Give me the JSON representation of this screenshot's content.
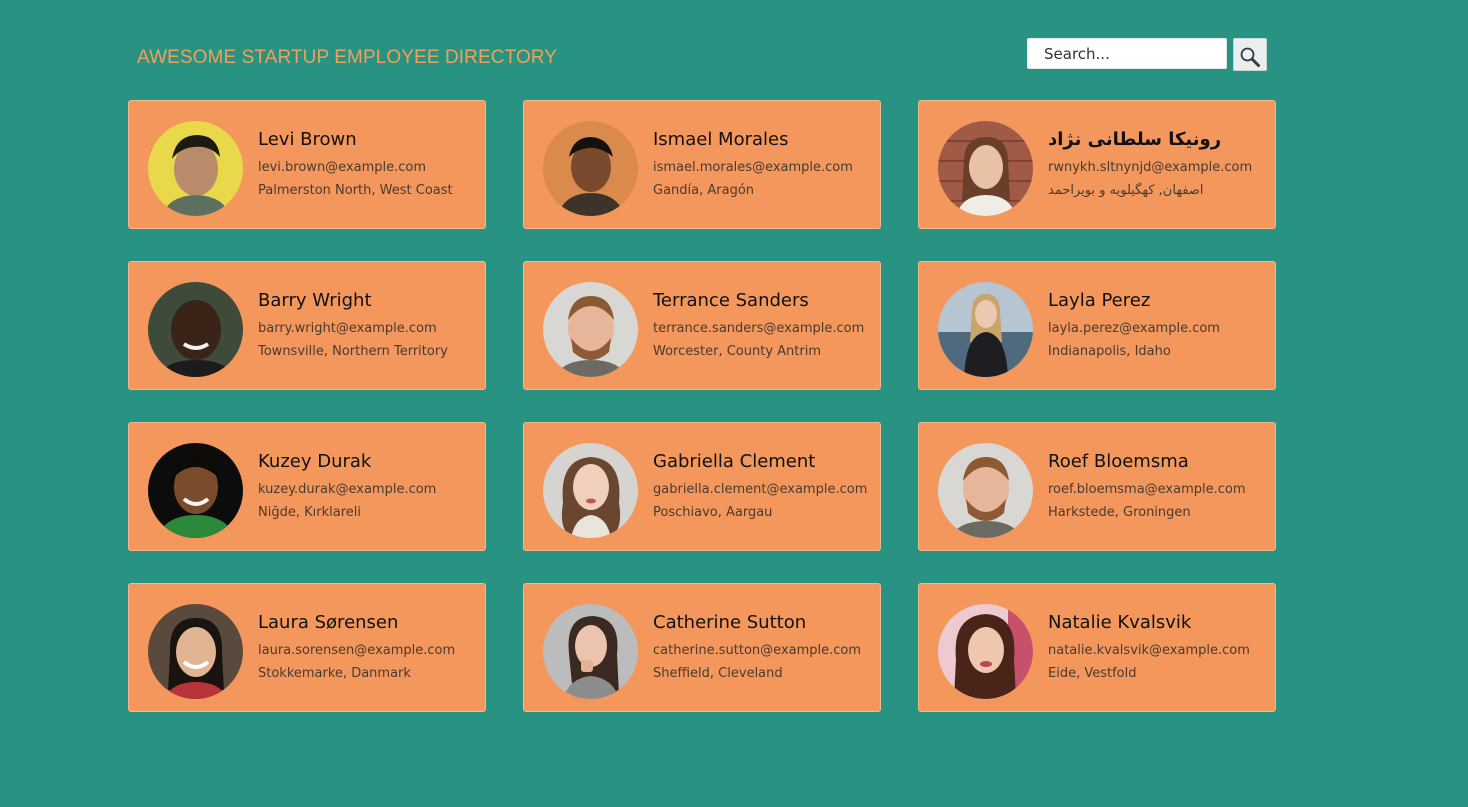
{
  "header": {
    "title": "AWESOME STARTUP EMPLOYEE DIRECTORY",
    "search_placeholder": "Search...",
    "search_icon": "magnifier-icon"
  },
  "colors": {
    "background": "#289382",
    "card": "#f3975c",
    "title": "#f0a05a"
  },
  "employees": [
    {
      "name": "Levi Brown",
      "email": "levi.brown@example.com",
      "location": "Palmerston North, West Coast"
    },
    {
      "name": "Ismael Morales",
      "email": "ismael.morales@example.com",
      "location": "Gandía, Aragón"
    },
    {
      "name": "رونیکا سلطانی نژاد",
      "email": "rwnykh.sltnynjd@example.com",
      "location": "اصفهان, کهگیلویه و بویراحمد"
    },
    {
      "name": "Barry Wright",
      "email": "barry.wright@example.com",
      "location": "Townsville, Northern Territory"
    },
    {
      "name": "Terrance Sanders",
      "email": "terrance.sanders@example.com",
      "location": "Worcester, County Antrim"
    },
    {
      "name": "Layla Perez",
      "email": "layla.perez@example.com",
      "location": "Indianapolis, Idaho"
    },
    {
      "name": "Kuzey Durak",
      "email": "kuzey.durak@example.com",
      "location": "Niğde, Kırklareli"
    },
    {
      "name": "Gabriella Clement",
      "email": "gabriella.clement@example.com",
      "location": "Poschiavo, Aargau"
    },
    {
      "name": "Roef Bloemsma",
      "email": "roef.bloemsma@example.com",
      "location": "Harkstede, Groningen"
    },
    {
      "name": "Laura Sørensen",
      "email": "laura.sorensen@example.com",
      "location": "Stokkemarke, Danmark"
    },
    {
      "name": "Catherine Sutton",
      "email": "catherine.sutton@example.com",
      "location": "Sheffield, Cleveland"
    },
    {
      "name": "Natalie Kvalsvik",
      "email": "natalie.kvalsvik@example.com",
      "location": "Eide, Vestfold"
    }
  ]
}
